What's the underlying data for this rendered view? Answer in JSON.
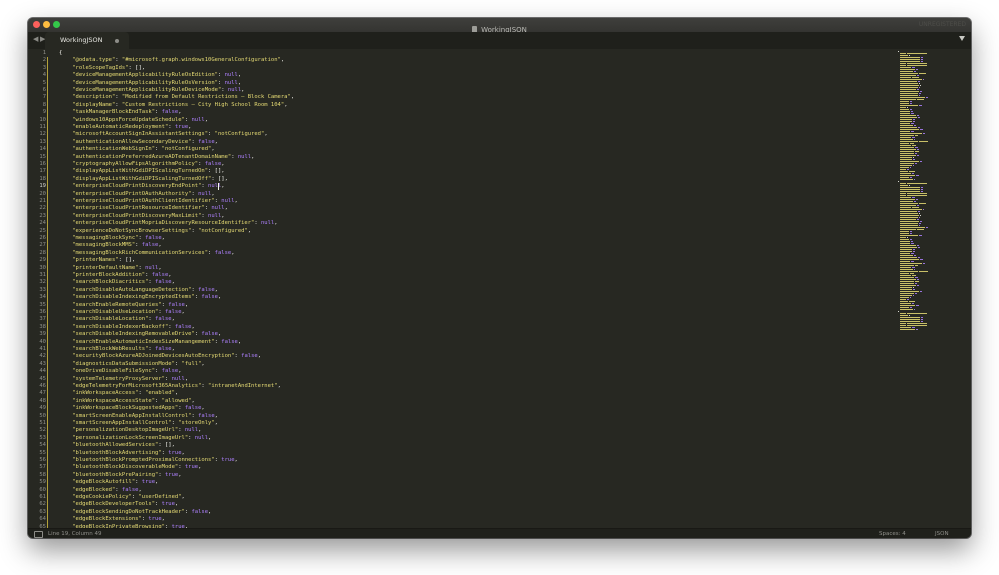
{
  "window": {
    "title": "WorkingJSON",
    "unregistered": "UNREGISTERED",
    "colors": {
      "background": "#272822",
      "close": "#fc605c",
      "minimize": "#fdbc40",
      "zoom": "#34c84a"
    }
  },
  "tabbar": {
    "back": "◀",
    "forward": "▶",
    "tab_label": "WorkingJSON"
  },
  "statusbar": {
    "position": "Line 19, Column 49",
    "spaces": "Spaces: 4",
    "syntax": "JSON"
  },
  "editor": {
    "current_line": 19,
    "lines": [
      {
        "type": "open",
        "text": "{"
      },
      {
        "type": "kv",
        "key": "\"@odata.type\"",
        "value": "\"#microsoft.graph.windows10GeneralConfiguration\"",
        "vtype": "s"
      },
      {
        "type": "kv",
        "key": "\"roleScopeTagIds\"",
        "value": "[]",
        "vtype": "br"
      },
      {
        "type": "kv",
        "key": "\"deviceManagementApplicabilityRuleOsEdition\"",
        "value": "null",
        "vtype": "lit"
      },
      {
        "type": "kv",
        "key": "\"deviceManagementApplicabilityRuleOsVersion\"",
        "value": "null",
        "vtype": "lit"
      },
      {
        "type": "kv",
        "key": "\"deviceManagementApplicabilityRuleDeviceMode\"",
        "value": "null",
        "vtype": "lit"
      },
      {
        "type": "kv",
        "key": "\"description\"",
        "value": "\"Modified from Default Restrictions – Block Camera\"",
        "vtype": "s"
      },
      {
        "type": "kv",
        "key": "\"displayName\"",
        "value": "\"Custom Restrictions – City High School Room 104\"",
        "vtype": "s"
      },
      {
        "type": "kv",
        "key": "\"taskManagerBlockEndTask\"",
        "value": "false",
        "vtype": "lit"
      },
      {
        "type": "kv",
        "key": "\"windows10AppsForceUpdateSchedule\"",
        "value": "null",
        "vtype": "lit"
      },
      {
        "type": "kv",
        "key": "\"enableAutomaticRedeployment\"",
        "value": "true",
        "vtype": "lit"
      },
      {
        "type": "kv",
        "key": "\"microsoftAccountSignInAssistantSettings\"",
        "value": "\"notConfigured\"",
        "vtype": "s"
      },
      {
        "type": "kv",
        "key": "\"authenticationAllowSecondaryDevice\"",
        "value": "false",
        "vtype": "lit"
      },
      {
        "type": "kv",
        "key": "\"authenticationWebSignIn\"",
        "value": "\"notConfigured\"",
        "vtype": "s"
      },
      {
        "type": "kv",
        "key": "\"authenticationPreferredAzureADTenantDomainName\"",
        "value": "null",
        "vtype": "lit"
      },
      {
        "type": "kv",
        "key": "\"cryptographyAllowFipsAlgorithmPolicy\"",
        "value": "false",
        "vtype": "lit"
      },
      {
        "type": "kv",
        "key": "\"displayAppListWithGdiDPIScalingTurnedOn\"",
        "value": "[]",
        "vtype": "br"
      },
      {
        "type": "kv",
        "key": "\"displayAppListWithGdiDPIScalingTurnedOff\"",
        "value": "[]",
        "vtype": "br"
      },
      {
        "type": "kv",
        "key": "\"enterpriseCloudPrintDiscoveryEndPoint\"",
        "value": "null",
        "vtype": "lit"
      },
      {
        "type": "kv",
        "key": "\"enterpriseCloudPrintOAuthAuthority\"",
        "value": "null",
        "vtype": "lit"
      },
      {
        "type": "kv",
        "key": "\"enterpriseCloudPrintOAuthClientIdentifier\"",
        "value": "null",
        "vtype": "lit"
      },
      {
        "type": "kv",
        "key": "\"enterpriseCloudPrintResourceIdentifier\"",
        "value": "null",
        "vtype": "lit"
      },
      {
        "type": "kv",
        "key": "\"enterpriseCloudPrintDiscoveryMaxLimit\"",
        "value": "null",
        "vtype": "lit"
      },
      {
        "type": "kv",
        "key": "\"enterpriseCloudPrintMopriaDiscoveryResourceIdentifier\"",
        "value": "null",
        "vtype": "lit"
      },
      {
        "type": "kv",
        "key": "\"experienceDoNotSyncBrowserSettings\"",
        "value": "\"notConfigured\"",
        "vtype": "s"
      },
      {
        "type": "kv",
        "key": "\"messagingBlockSync\"",
        "value": "false",
        "vtype": "lit"
      },
      {
        "type": "kv",
        "key": "\"messagingBlockMMS\"",
        "value": "false",
        "vtype": "lit"
      },
      {
        "type": "kv",
        "key": "\"messagingBlockRichCommunicationServices\"",
        "value": "false",
        "vtype": "lit"
      },
      {
        "type": "kv",
        "key": "\"printerNames\"",
        "value": "[]",
        "vtype": "br"
      },
      {
        "type": "kv",
        "key": "\"printerDefaultName\"",
        "value": "null",
        "vtype": "lit"
      },
      {
        "type": "kv",
        "key": "\"printerBlockAddition\"",
        "value": "false",
        "vtype": "lit"
      },
      {
        "type": "kv",
        "key": "\"searchBlockDiacritics\"",
        "value": "false",
        "vtype": "lit"
      },
      {
        "type": "kv",
        "key": "\"searchDisableAutoLanguageDetection\"",
        "value": "false",
        "vtype": "lit"
      },
      {
        "type": "kv",
        "key": "\"searchDisableIndexingEncryptedItems\"",
        "value": "false",
        "vtype": "lit"
      },
      {
        "type": "kv",
        "key": "\"searchEnableRemoteQueries\"",
        "value": "false",
        "vtype": "lit"
      },
      {
        "type": "kv",
        "key": "\"searchDisableUseLocation\"",
        "value": "false",
        "vtype": "lit"
      },
      {
        "type": "kv",
        "key": "\"searchDisableLocation\"",
        "value": "false",
        "vtype": "lit"
      },
      {
        "type": "kv",
        "key": "\"searchDisableIndexerBackoff\"",
        "value": "false",
        "vtype": "lit"
      },
      {
        "type": "kv",
        "key": "\"searchDisableIndexingRemovableDrive\"",
        "value": "false",
        "vtype": "lit"
      },
      {
        "type": "kv",
        "key": "\"searchEnableAutomaticIndexSizeManangement\"",
        "value": "false",
        "vtype": "lit"
      },
      {
        "type": "kv",
        "key": "\"searchBlockWebResults\"",
        "value": "false",
        "vtype": "lit"
      },
      {
        "type": "kv",
        "key": "\"securityBlockAzureADJoinedDevicesAutoEncryption\"",
        "value": "false",
        "vtype": "lit"
      },
      {
        "type": "kv",
        "key": "\"diagnosticsDataSubmissionMode\"",
        "value": "\"full\"",
        "vtype": "s"
      },
      {
        "type": "kv",
        "key": "\"oneDriveDisableFileSync\"",
        "value": "false",
        "vtype": "lit"
      },
      {
        "type": "kv",
        "key": "\"systemTelemetryProxyServer\"",
        "value": "null",
        "vtype": "lit"
      },
      {
        "type": "kv",
        "key": "\"edgeTelemetryForMicrosoft365Analytics\"",
        "value": "\"intranetAndInternet\"",
        "vtype": "s"
      },
      {
        "type": "kv",
        "key": "\"inkWorkspaceAccess\"",
        "value": "\"enabled\"",
        "vtype": "s"
      },
      {
        "type": "kv",
        "key": "\"inkWorkspaceAccessState\"",
        "value": "\"allowed\"",
        "vtype": "s"
      },
      {
        "type": "kv",
        "key": "\"inkWorkspaceBlockSuggestedApps\"",
        "value": "false",
        "vtype": "lit"
      },
      {
        "type": "kv",
        "key": "\"smartScreenEnableAppInstallControl\"",
        "value": "false",
        "vtype": "lit"
      },
      {
        "type": "kv",
        "key": "\"smartScreenAppInstallControl\"",
        "value": "\"storeOnly\"",
        "vtype": "s"
      },
      {
        "type": "kv",
        "key": "\"personalizationDesktopImageUrl\"",
        "value": "null",
        "vtype": "lit"
      },
      {
        "type": "kv",
        "key": "\"personalizationLockScreenImageUrl\"",
        "value": "null",
        "vtype": "lit"
      },
      {
        "type": "kv",
        "key": "\"bluetoothAllowedServices\"",
        "value": "[]",
        "vtype": "br"
      },
      {
        "type": "kv",
        "key": "\"bluetoothBlockAdvertising\"",
        "value": "true",
        "vtype": "lit"
      },
      {
        "type": "kv",
        "key": "\"bluetoothBlockPromptedProximalConnections\"",
        "value": "true",
        "vtype": "lit"
      },
      {
        "type": "kv",
        "key": "\"bluetoothBlockDiscoverableMode\"",
        "value": "true",
        "vtype": "lit"
      },
      {
        "type": "kv",
        "key": "\"bluetoothBlockPrePairing\"",
        "value": "true",
        "vtype": "lit"
      },
      {
        "type": "kv",
        "key": "\"edgeBlockAutofill\"",
        "value": "true",
        "vtype": "lit"
      },
      {
        "type": "kv",
        "key": "\"edgeBlocked\"",
        "value": "false",
        "vtype": "lit"
      },
      {
        "type": "kv",
        "key": "\"edgeCookiePolicy\"",
        "value": "\"userDefined\"",
        "vtype": "s"
      },
      {
        "type": "kv",
        "key": "\"edgeBlockDeveloperTools\"",
        "value": "true",
        "vtype": "lit"
      },
      {
        "type": "kv",
        "key": "\"edgeBlockSendingDoNotTrackHeader\"",
        "value": "false",
        "vtype": "lit"
      },
      {
        "type": "kv",
        "key": "\"edgeBlockExtensions\"",
        "value": "true",
        "vtype": "lit"
      },
      {
        "type": "kv",
        "key": "\"edgeBlockInPrivateBrowsing\"",
        "value": "true",
        "vtype": "lit"
      }
    ]
  }
}
